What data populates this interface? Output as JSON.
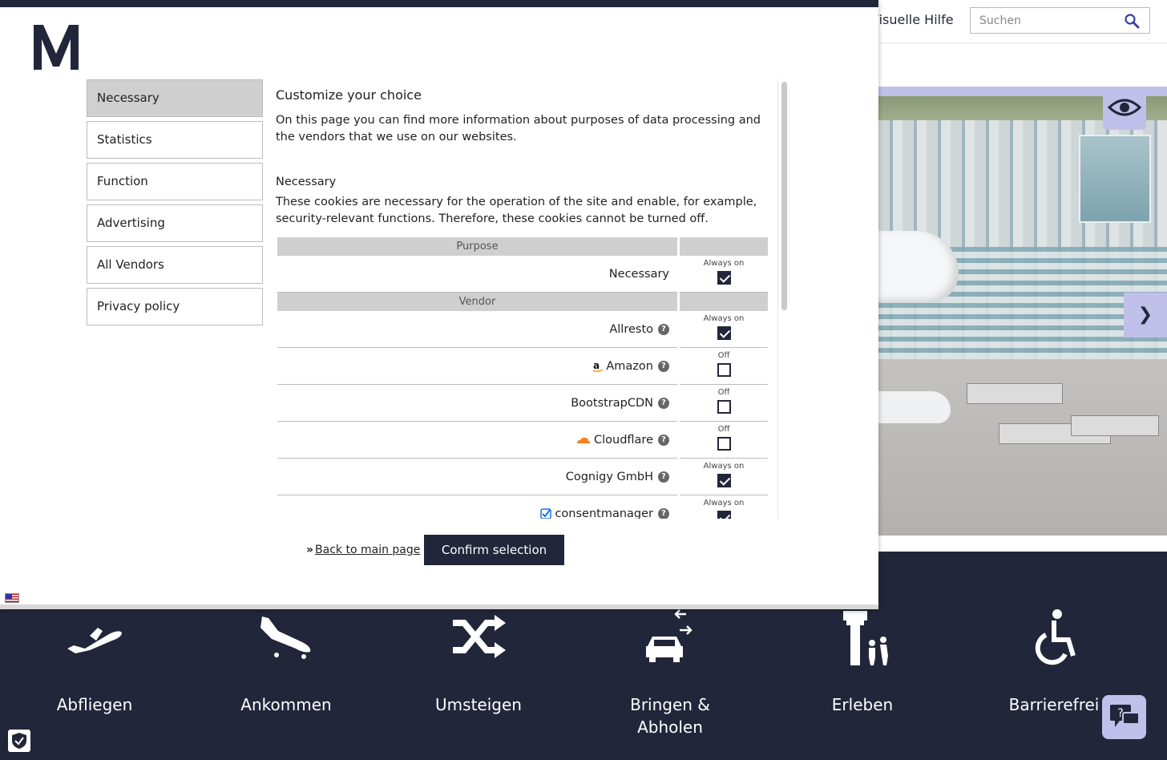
{
  "header": {
    "visual_help": "Visuelle Hilfe",
    "search_placeholder": "Suchen"
  },
  "hero": {
    "next_glyph": "❯"
  },
  "nav": [
    {
      "label": "Abfliegen",
      "icon": "plane-departure-icon"
    },
    {
      "label": "Ankommen",
      "icon": "plane-arrival-icon"
    },
    {
      "label": "Umsteigen",
      "icon": "transfer-shuffle-icon"
    },
    {
      "label": "Bringen & Abholen",
      "icon": "car-pickup-icon"
    },
    {
      "label": "Erleben",
      "icon": "tower-family-icon"
    },
    {
      "label": "Barrierefrei",
      "icon": "wheelchair-icon"
    }
  ],
  "modal": {
    "sidebar": [
      "Necessary",
      "Statistics",
      "Function",
      "Advertising",
      "All Vendors",
      "Privacy policy"
    ],
    "active_item": "Necessary",
    "title": "Customize your choice",
    "intro": "On this page you can find more information about purposes of data processing and the vendors that we use on our websites.",
    "section_title": "Necessary",
    "section_text": "These cookies are necessary for the operation of the site and enable, for example, security-relevant functions. Therefore, these cookies cannot be turned off.",
    "purpose_header": "Purpose",
    "vendor_header": "Vendor",
    "purposes": [
      {
        "name": "Necessary",
        "state": "Always on",
        "checked": true
      }
    ],
    "vendors": [
      {
        "name": "Allresto",
        "state": "Always on",
        "checked": true,
        "icon": ""
      },
      {
        "name": "Amazon",
        "state": "Off",
        "checked": false,
        "icon": "amazon-logo-icon"
      },
      {
        "name": "BootstrapCDN",
        "state": "Off",
        "checked": false,
        "icon": ""
      },
      {
        "name": "Cloudflare",
        "state": "Off",
        "checked": false,
        "icon": "cloudflare-logo-icon"
      },
      {
        "name": "Cognigy GmbH",
        "state": "Always on",
        "checked": true,
        "icon": ""
      },
      {
        "name": "consentmanager",
        "state": "Always on",
        "checked": true,
        "icon": "consentmanager-logo-icon"
      }
    ],
    "help_glyph": "?",
    "back_link": "Back to main page",
    "back_arrow": "»",
    "confirm": "Confirm selection"
  },
  "colors": {
    "brand_dark": "#22263a",
    "accent_lavender": "#c0c0ea"
  }
}
